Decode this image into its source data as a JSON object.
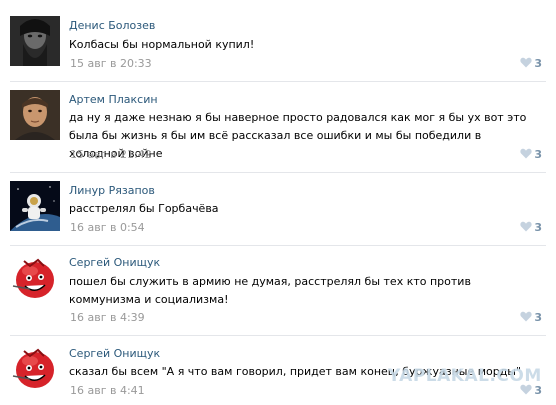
{
  "comments": [
    {
      "author": "Денис Болозев",
      "text": "Колбасы бы нормальной купил!",
      "timestamp": "15 авг в 20:33",
      "likes": "3",
      "avatar": "portrait-bearded-man"
    },
    {
      "author": "Артем Плаксин",
      "text": "да ну я даже незнаю я бы наверное просто радовался как мог я бы ух вот это была бы жизнь я бы им всё рассказал все ошибки и мы бы победили в холодной войне",
      "timestamp": "15 авг в 21:42",
      "likes": "3",
      "avatar": "portrait-man"
    },
    {
      "author": "Линур Рязапов",
      "text": "расстрелял бы Горбачёва",
      "timestamp": "16 авг в 0:54",
      "likes": "3",
      "avatar": "astronaut-over-earth"
    },
    {
      "author": "Сергей Онищук",
      "text": "пошел бы служить в армию не думая, расстрелял бы тех кто против коммунизма и социализма!",
      "timestamp": "16 авг в 4:39",
      "likes": "3",
      "avatar": "red-ball-face"
    },
    {
      "author": "Сергей Онищук",
      "text": "сказал бы всем \"А я что вам говорил, придет вам конец, буржуазные морды\"",
      "timestamp": "16 авг в 4:41",
      "likes": "3",
      "avatar": "red-ball-face"
    }
  ],
  "watermark": "YAPLAKAL.COM",
  "colors": {
    "author_link": "#2b587a",
    "meta_gray": "#999999",
    "like_blue": "#7993aa",
    "divider": "#e4e6ea"
  }
}
